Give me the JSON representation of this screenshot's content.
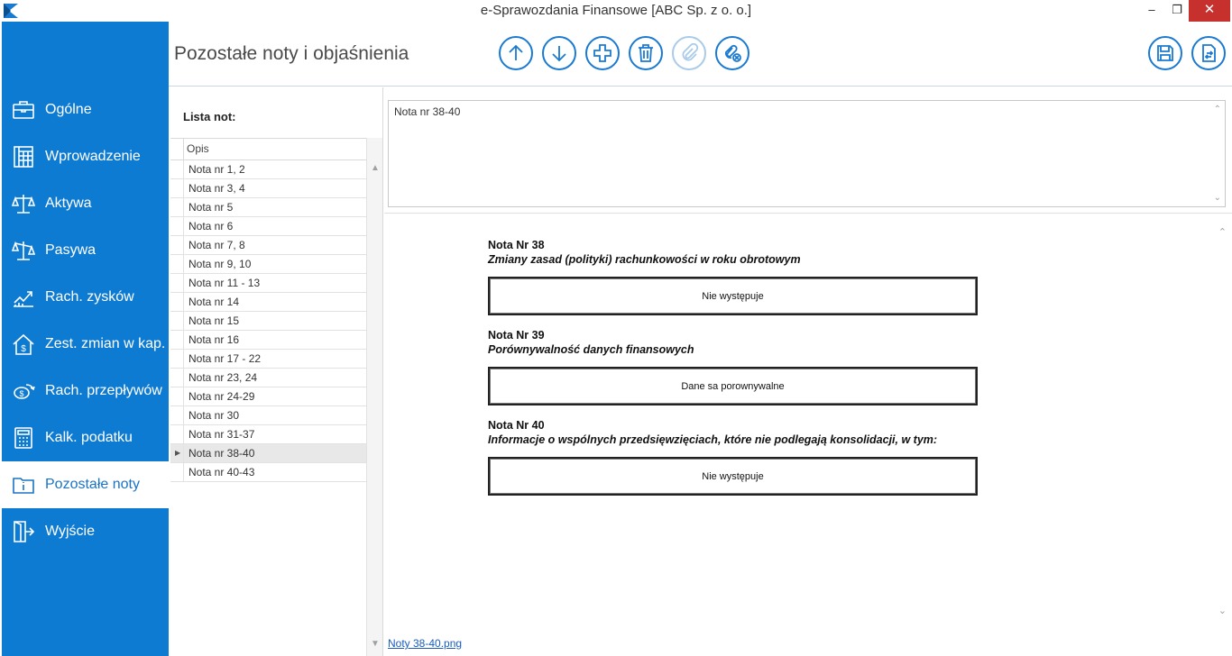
{
  "window": {
    "title": "e-Sprawozdania Finansowe  [ABC Sp. z o. o.]",
    "minimize_glyph": "–",
    "maximize_glyph": "❐",
    "close_glyph": "✕"
  },
  "colors": {
    "sidebar_bg": "#0e7bd2",
    "accent": "#1a7ad1",
    "close_bg": "#c7312d"
  },
  "sidebar": {
    "items": [
      {
        "label": "Ogólne",
        "icon": "briefcase-icon"
      },
      {
        "label": "Wprowadzenie",
        "icon": "building-icon"
      },
      {
        "label": "Aktywa",
        "icon": "scales-icon"
      },
      {
        "label": "Pasywa",
        "icon": "scales-icon"
      },
      {
        "label": "Rach. zysków",
        "icon": "chart-up-icon"
      },
      {
        "label": "Zest. zmian w kap.",
        "icon": "house-dollar-icon"
      },
      {
        "label": "Rach. przepływów",
        "icon": "cash-flow-icon"
      },
      {
        "label": "Kalk. podatku",
        "icon": "calculator-icon"
      },
      {
        "label": "Pozostałe noty",
        "icon": "info-folder-icon",
        "active": true
      },
      {
        "label": "Wyjście",
        "icon": "exit-door-icon"
      }
    ]
  },
  "header": {
    "title": "Pozostałe noty i objaśnienia",
    "toolbar": [
      "move-up-icon",
      "move-down-icon",
      "add-icon",
      "delete-icon",
      "attach-icon",
      "remove-attachment-icon",
      "save-icon",
      "export-icon"
    ]
  },
  "list": {
    "label": "Lista not:",
    "column": "Opis",
    "rows": [
      "Nota nr 1, 2",
      "Nota nr 3, 4",
      "Nota nr 5",
      "Nota nr 6",
      "Nota nr 7, 8",
      "Nota nr 9, 10",
      "Nota nr 11 - 13",
      "Nota nr 14",
      "Nota nr 15",
      "Nota nr 16",
      "Nota nr 17 - 22",
      "Nota nr 23, 24",
      "Nota nr 24-29",
      "Nota nr 30",
      "Nota nr 31-37",
      "Nota nr 38-40",
      "Nota nr 40-43"
    ],
    "selected_marker": "▶"
  },
  "note": {
    "text": "Nota nr 38-40"
  },
  "preview": {
    "notes": [
      {
        "head": "Nota Nr 38",
        "sub": "Zmiany zasad (polityki) rachunkowości w roku obrotowym",
        "box": "Nie występuje"
      },
      {
        "head": "Nota Nr 39",
        "sub": "Porównywalność danych finansowych",
        "box": "Dane sa porownywalne"
      },
      {
        "head": "Nota Nr 40",
        "sub": "Informacje o wspólnych przedsięwzięciach, które nie podlegają konsolidacji, w tym:",
        "box": "Nie występuje"
      }
    ],
    "file_link": "Noty 38-40.png"
  }
}
